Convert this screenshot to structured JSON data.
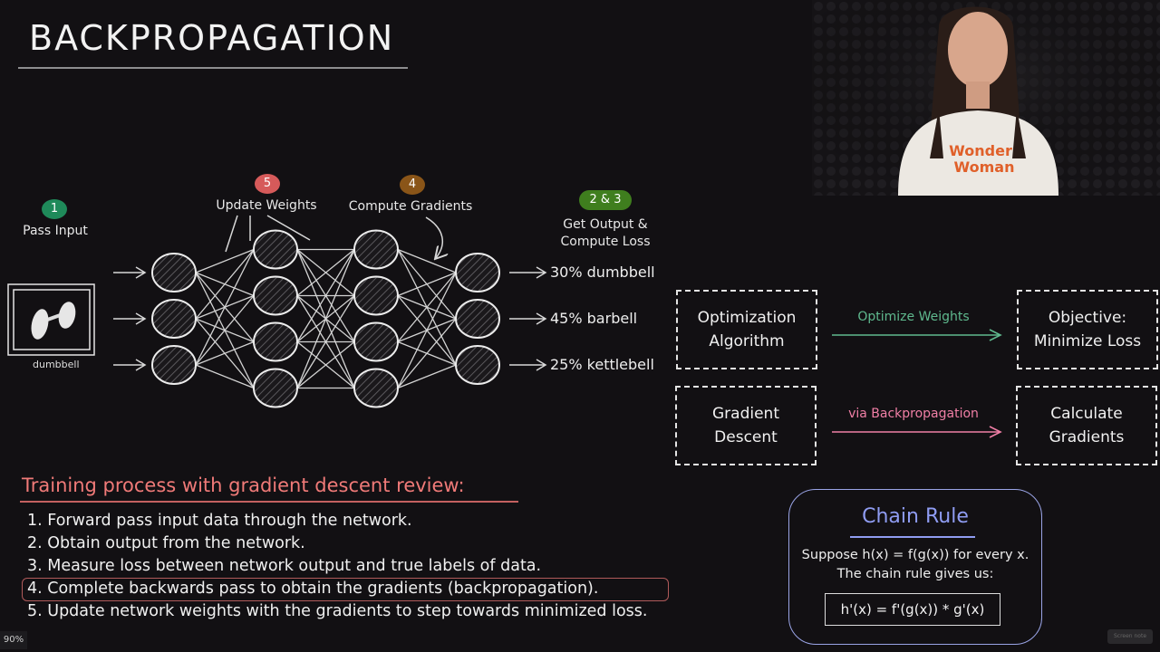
{
  "title": "BACKPROPAGATION",
  "network": {
    "layers": [
      3,
      4,
      4,
      3
    ],
    "input_image_caption": "dumbbell",
    "steps": [
      {
        "badge": "1",
        "label": "Pass Input",
        "color": "#1f8a5a"
      },
      {
        "badge": "5",
        "label": "Update Weights",
        "color": "#d65a5a"
      },
      {
        "badge": "4",
        "label": "Compute Gradients",
        "color": "#8a5518"
      },
      {
        "badge": "2 & 3",
        "label_line1": "Get Output &",
        "label_line2": "Compute Loss",
        "color": "#3f7e1e"
      }
    ],
    "outputs": [
      {
        "percent": "30%",
        "class": "dumbbell",
        "text": "30% dumbbell"
      },
      {
        "percent": "45%",
        "class": "barbell",
        "text": "45% barbell"
      },
      {
        "percent": "25%",
        "class": "kettlebell",
        "text": "25% kettlebell"
      }
    ]
  },
  "concept_map": {
    "row1": {
      "left_line1": "Optimization",
      "left_line2": "Algorithm",
      "arrow_label": "Optimize Weights",
      "arrow_color": "#5fb98e",
      "right_line1": "Objective:",
      "right_line2": "Minimize Loss"
    },
    "row2": {
      "left_line1": "Gradient",
      "left_line2": "Descent",
      "arrow_label": "via Backpropagation",
      "arrow_color": "#f07fa6",
      "right_line1": "Calculate",
      "right_line2": "Gradients"
    }
  },
  "review": {
    "title": "Training process with gradient descent review:",
    "title_color": "#f07a78",
    "steps": [
      "1. Forward pass input data through the network.",
      "2. Obtain output from the network.",
      "3. Measure loss between network output and true labels of data.",
      "4. Complete backwards pass to obtain the gradients (backpropagation).",
      "5. Update network weights with the gradients to step towards minimized loss."
    ],
    "highlighted_step_index": 3
  },
  "chain_rule": {
    "title": "Chain Rule",
    "description_line1": "Suppose h(x) = f(g(x)) for every x.",
    "description_line2": "The chain rule gives us:",
    "formula": "h'(x) = f'(g(x)) * g'(x)",
    "accent": "#8f9cf2"
  },
  "webcam": {
    "shirt_text_line1": "Wonder",
    "shirt_text_line2": "Woman"
  },
  "player": {
    "zoom_level": "90%",
    "corner_control": "Screen note"
  }
}
